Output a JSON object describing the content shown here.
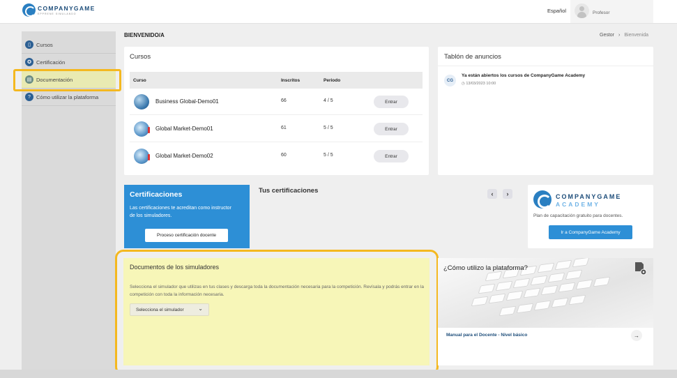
{
  "header": {
    "logo_text": "COMPANYGAME",
    "logo_subtext": "EPPRENE SIMULANDO",
    "language": "Español",
    "user_role": "Profesor"
  },
  "sidebar": {
    "items": [
      {
        "label": "Cursos",
        "icon": "book-icon"
      },
      {
        "label": "Certificación",
        "icon": "certificate-icon"
      },
      {
        "label": "Documentación",
        "icon": "document-icon",
        "active": true
      },
      {
        "label": "Cómo utilizar la plataforma",
        "icon": "help-icon"
      }
    ]
  },
  "page": {
    "title": "BIENVENIDO/A",
    "breadcrumb": [
      "Gestor",
      "Bienvenida"
    ]
  },
  "courses": {
    "title": "Cursos",
    "columns": [
      "Curso",
      "Inscritos",
      "Periodo"
    ],
    "rows": [
      {
        "name": "Business Global-Demo01",
        "enrolled": "66",
        "period": "4 / 5",
        "action": "Entrar"
      },
      {
        "name": "Global Market-Demo01",
        "enrolled": "61",
        "period": "5 / 5",
        "action": "Entrar"
      },
      {
        "name": "Global Market-Demo02",
        "enrolled": "60",
        "period": "5 / 5",
        "action": "Entrar"
      }
    ]
  },
  "announcements": {
    "title": "Tablón de anuncios",
    "items": [
      {
        "avatar": "CG",
        "title": "Ya están abiertos los cursos de CompanyGame Academy",
        "date": "13/03/2023 10:00"
      }
    ]
  },
  "certifications": {
    "title": "Certificaciones",
    "description": "Las certificaciones te acreditan como instructor de los simuladores.",
    "button": "Proceso certificación docente",
    "section_title": "Tus certificaciones",
    "prev": "‹",
    "next": "›"
  },
  "academy": {
    "title_line1": "COMPANYGAME",
    "title_line2": "ACADEMY",
    "description": "Plan de capacitación gratuito para docentes.",
    "button": "Ir a CompanyGame Academy"
  },
  "documents": {
    "title": "Documentos de los simuladores",
    "description": "Selecciona el simulador que utilizas en tus clases y descarga toda la documentación necesaria para la competición. Revísala y podrás entrar en la competición con toda la información necesaria.",
    "select_value": "Selecciona el simulador"
  },
  "howto": {
    "title": "¿Cómo utilizo la plataforma?",
    "manual_link": "Manual para el Docente - Nivel básico"
  },
  "colors": {
    "primary": "#2d8fd6",
    "highlight": "#f4b820",
    "docs_bg": "#f7f6b8"
  }
}
